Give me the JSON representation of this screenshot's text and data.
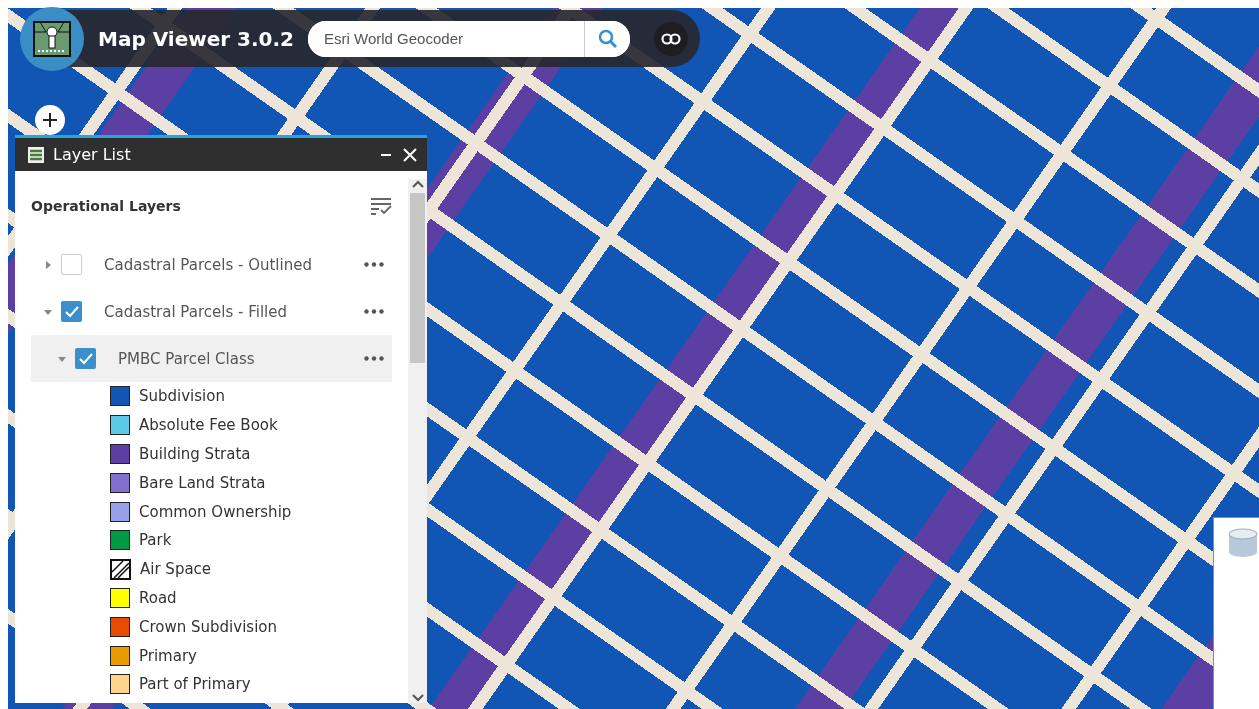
{
  "header": {
    "title": "Map Viewer 3.0.2",
    "search": {
      "placeholder": "Esri World Geocoder"
    }
  },
  "layer_panel": {
    "title": "Layer List",
    "section_title": "Operational Layers",
    "layers": [
      {
        "label": "Cadastral Parcels - Outlined",
        "checked": false,
        "expanded": false,
        "selected": false
      },
      {
        "label": "Cadastral Parcels - Filled",
        "checked": true,
        "expanded": true,
        "selected": false,
        "children": [
          {
            "label": "PMBC Parcel Class",
            "checked": true,
            "expanded": true,
            "selected": true,
            "legend": [
              {
                "label": "Subdivision",
                "kind": "solid",
                "color": "#1155b5"
              },
              {
                "label": "Absolute Fee Book",
                "kind": "solid",
                "color": "#5bc8e8"
              },
              {
                "label": "Building Strata",
                "kind": "solid",
                "color": "#5c3fa3"
              },
              {
                "label": "Bare Land Strata",
                "kind": "solid",
                "color": "#8270d0"
              },
              {
                "label": "Common Ownership",
                "kind": "solid",
                "color": "#97a0e8"
              },
              {
                "label": "Park",
                "kind": "solid",
                "color": "#009a44"
              },
              {
                "label": "Air Space",
                "kind": "hatched"
              },
              {
                "label": "Road",
                "kind": "solid",
                "color": "#ffff00"
              },
              {
                "label": "Crown Subdivision",
                "kind": "solid",
                "color": "#e84c00"
              },
              {
                "label": "Primary",
                "kind": "solid",
                "color": "#e89a00"
              },
              {
                "label": "Part of Primary",
                "kind": "solid",
                "color": "#ffd48c"
              }
            ]
          }
        ]
      }
    ]
  }
}
